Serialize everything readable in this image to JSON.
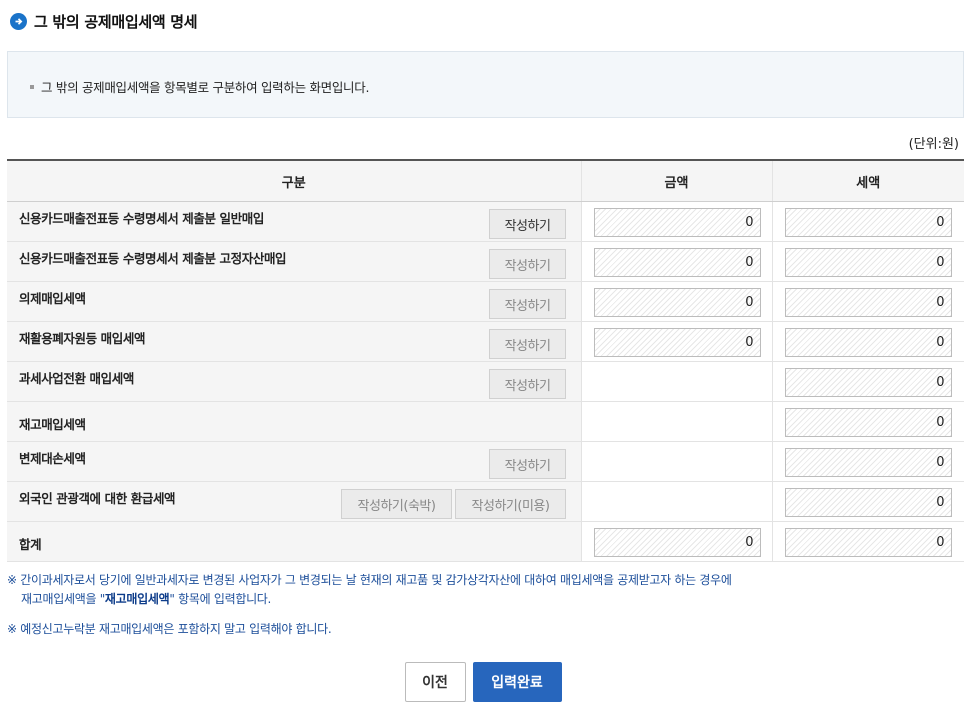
{
  "title": "그 밖의 공제매입세액 명세",
  "description": "그 밖의 공제매입세액을 항목별로 구분하여 입력하는 화면입니다.",
  "unit": "(단위:원)",
  "columns": {
    "category": "구분",
    "amount": "금액",
    "tax": "세액"
  },
  "rows": [
    {
      "label": "신용카드매출전표등 수령명세서 제출분 일반매입",
      "button": "작성하기",
      "amount": "0",
      "tax": "0"
    },
    {
      "label": "신용카드매출전표등 수령명세서 제출분 고정자산매입",
      "button": "작성하기",
      "amount": "0",
      "tax": "0"
    },
    {
      "label": "의제매입세액",
      "button": "작성하기",
      "amount": "0",
      "tax": "0"
    },
    {
      "label": "재활용폐자원등 매입세액",
      "button": "작성하기",
      "amount": "0",
      "tax": "0"
    },
    {
      "label": "과세사업전환 매입세액",
      "button": "작성하기",
      "tax": "0"
    },
    {
      "label": "재고매입세액",
      "tax": "0"
    },
    {
      "label": "변제대손세액",
      "button": "작성하기",
      "tax": "0"
    },
    {
      "label": "외국인 관광객에 대한 환급세액",
      "button_a": "작성하기(숙박)",
      "button_b": "작성하기(미용)",
      "tax": "0"
    },
    {
      "label": "합계",
      "amount": "0",
      "tax": "0"
    }
  ],
  "notes": {
    "note1_a": "※ 간이과세자로서 당기에 일반과세자로 변경된 사업자가 그 변경되는 날 현재의 재고품 및 감가상각자산에 대하여 매입세액을 공제받고자 하는 경우에",
    "note1_b_pre": "재고매입세액을 \"",
    "note1_b_bold": "재고매입세액",
    "note1_b_post": "\" 항목에 입력합니다.",
    "note2": "※ 예정신고누락분 재고매입세액은 포함하지 말고 입력해야 합니다."
  },
  "actions": {
    "prev": "이전",
    "done": "입력완료"
  },
  "colors": {
    "accent": "#2766bd",
    "note": "#1c4e9a"
  }
}
